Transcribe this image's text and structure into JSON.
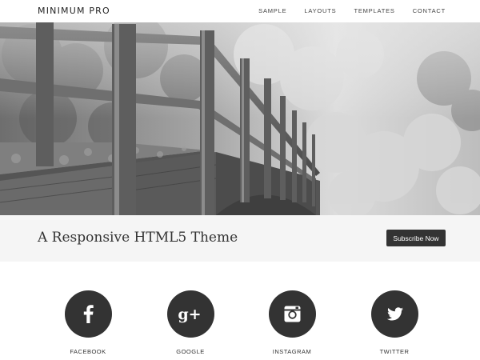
{
  "header": {
    "site_title": "MINIMUM PRO",
    "nav": [
      "SAMPLE",
      "LAYOUTS",
      "TEMPLATES",
      "CONTACT"
    ]
  },
  "hero": {
    "image": "black-and-white photo of a wooden footbridge with railings leading into a misty forest"
  },
  "tagline": {
    "text": "A Responsive HTML5 Theme",
    "button_label": "Subscribe Now"
  },
  "social": [
    {
      "label": "FACEBOOK",
      "icon": "facebook-icon"
    },
    {
      "label": "GOOGLE",
      "icon": "google-plus-icon"
    },
    {
      "label": "INSTAGRAM",
      "icon": "instagram-icon"
    },
    {
      "label": "TWITTER",
      "icon": "twitter-icon"
    }
  ],
  "colors": {
    "dark": "#333333",
    "band": "#f5f5f5",
    "white": "#ffffff"
  }
}
